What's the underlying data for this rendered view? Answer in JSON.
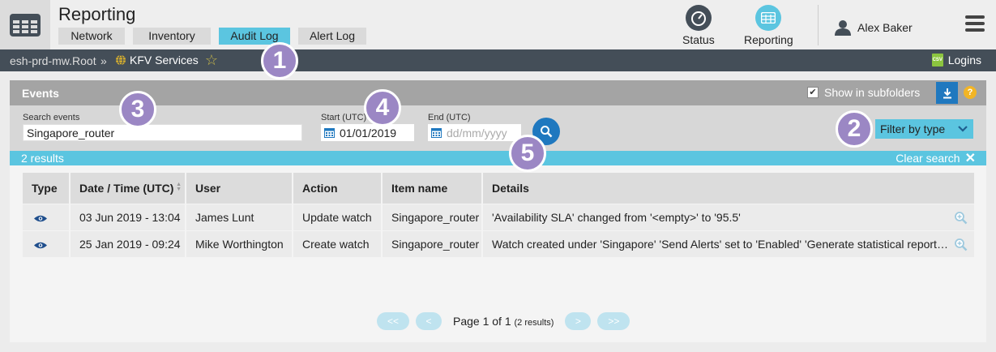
{
  "header": {
    "title": "Reporting",
    "tabs": [
      {
        "label": "Network",
        "active": false
      },
      {
        "label": "Inventory",
        "active": false
      },
      {
        "label": "Audit Log",
        "active": true
      },
      {
        "label": "Alert Log",
        "active": false
      }
    ],
    "nav": {
      "status_label": "Status",
      "reporting_label": "Reporting"
    },
    "user_name": "Alex Baker"
  },
  "breadcrumb": {
    "root": "esh-prd-mw.Root",
    "separator": "»",
    "current": "KFV Services",
    "logins_label": "Logins",
    "csv_icon_text": "CSV"
  },
  "events": {
    "title": "Events",
    "show_subfolders_label": "Show in subfolders",
    "show_subfolders_checked": true,
    "help_text": "?",
    "search_label": "Search events",
    "search_value": "Singapore_router",
    "start_label": "Start (UTC)",
    "start_value": "01/01/2019",
    "end_label": "End (UTC)",
    "end_placeholder": "dd/mm/yyyy",
    "filter_label": "Filter by type",
    "results_count": "2 results",
    "clear_search_label": "Clear search"
  },
  "table": {
    "columns": [
      "Type",
      "Date / Time (UTC)",
      "User",
      "Action",
      "Item name",
      "Details"
    ],
    "rows": [
      {
        "type_icon": "eye-icon",
        "datetime": "03 Jun 2019 - 13:04",
        "user": "James Lunt",
        "action": "Update watch",
        "item": "Singapore_router",
        "details": "'Availability SLA' changed from '<empty>' to '95.5'"
      },
      {
        "type_icon": "eye-icon",
        "datetime": "25 Jan 2019 - 09:24",
        "user": "Mike Worthington",
        "action": "Create watch",
        "item": "Singapore_router",
        "details": "Watch created under 'Singapore' 'Send Alerts' set to 'Enabled' 'Generate statistical reports' set to 'Enabled'"
      }
    ]
  },
  "pagination": {
    "first": "<<",
    "prev": "<",
    "text": "Page 1 of 1",
    "results_note": "(2 results)",
    "next": ">",
    "last": ">>"
  },
  "callouts": [
    "1",
    "2",
    "3",
    "4",
    "5"
  ],
  "colors": {
    "accent": "#5bc5e0",
    "primary_button": "#1f78bf",
    "dark_bar": "#444e58",
    "callout": "#9b87c4"
  }
}
